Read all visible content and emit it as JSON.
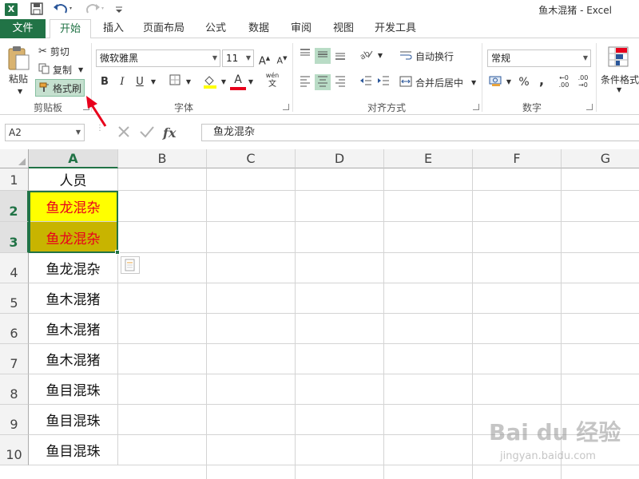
{
  "window": {
    "title": "鱼木混猪 - Excel",
    "logo_letter": "X"
  },
  "tabs": [
    {
      "label": "文件"
    },
    {
      "label": "开始"
    },
    {
      "label": "插入"
    },
    {
      "label": "页面布局"
    },
    {
      "label": "公式"
    },
    {
      "label": "数据"
    },
    {
      "label": "审阅"
    },
    {
      "label": "视图"
    },
    {
      "label": "开发工具"
    }
  ],
  "ribbon": {
    "clipboard": {
      "paste_label": "粘贴",
      "cut_label": "剪切",
      "copy_label": "复制",
      "format_painter_label": "格式刷",
      "group_label": "剪贴板"
    },
    "font": {
      "font_name": "微软雅黑",
      "font_size": "11",
      "bold": "B",
      "italic": "I",
      "underline": "U",
      "font_color_letter": "A",
      "phonetic_label": "wén",
      "group_label": "字体"
    },
    "alignment": {
      "wrap_text_label": "自动换行",
      "merge_center_label": "合并后居中",
      "group_label": "对齐方式"
    },
    "number": {
      "format_value": "常规",
      "percent": "%",
      "comma": ",",
      "group_label": "数字"
    },
    "styles": {
      "conditional_format_label": "条件格式"
    }
  },
  "formula_bar": {
    "name_box": "A2",
    "fx_label": "fx",
    "content": "鱼龙混杂"
  },
  "grid": {
    "columns": [
      "A",
      "B",
      "C",
      "D",
      "E",
      "F",
      "G"
    ],
    "rows": [
      "1",
      "2",
      "3",
      "4",
      "5",
      "6",
      "7",
      "8",
      "9",
      "10"
    ],
    "cells_col_a": [
      "人员",
      "鱼龙混杂",
      "鱼龙混杂",
      "鱼龙混杂",
      "鱼木混猪",
      "鱼木混猪",
      "鱼木混猪",
      "鱼目混珠",
      "鱼目混珠",
      "鱼目混珠"
    ]
  },
  "colors": {
    "brand": "#217346",
    "highlight_yellow": "#ffff00",
    "highlight_olive": "#c8b400",
    "red_text": "#e8001c",
    "arrow": "#e8001c"
  },
  "watermark": {
    "brand": "Bai du 经验",
    "url": "jingyan.baidu.com"
  }
}
